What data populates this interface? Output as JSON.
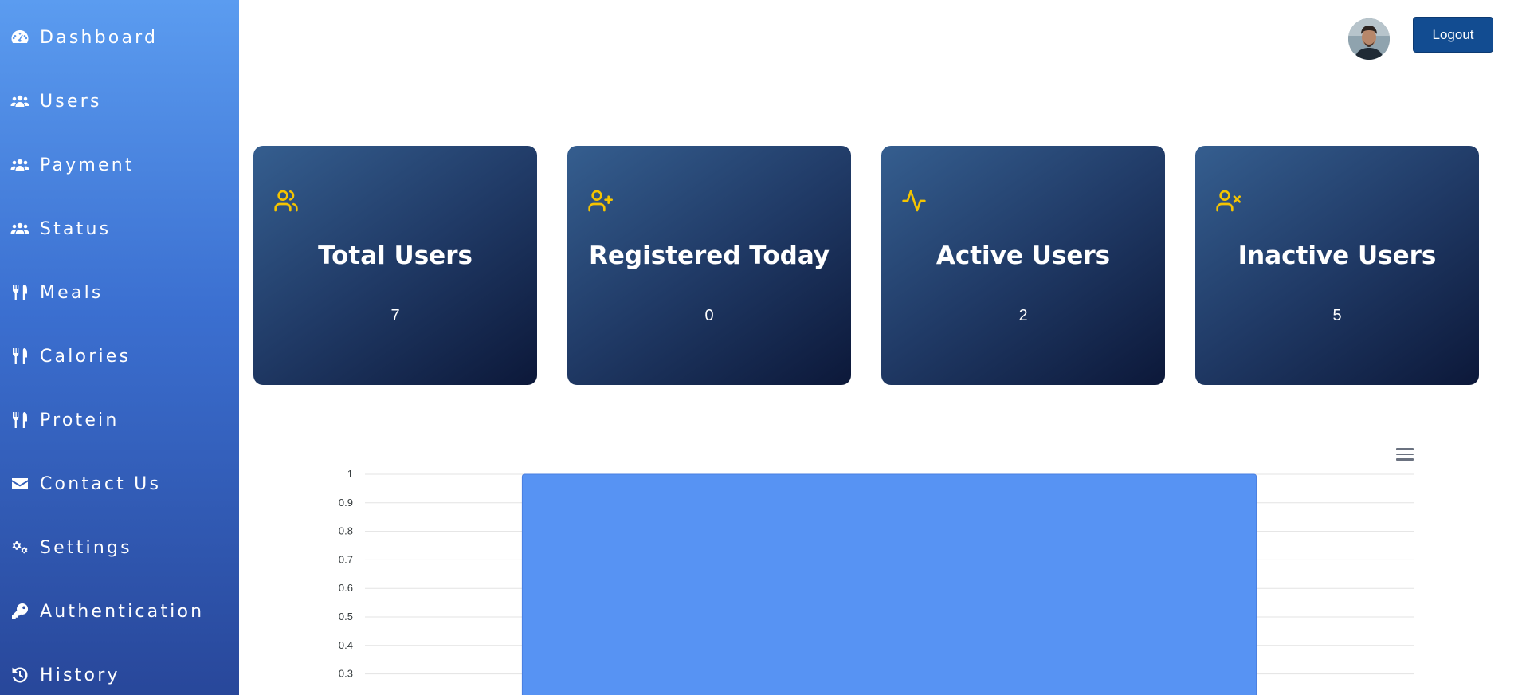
{
  "sidebar": {
    "items": [
      {
        "label": "Dashboard",
        "icon": "gauge-icon"
      },
      {
        "label": "Users",
        "icon": "users-icon"
      },
      {
        "label": "Payment",
        "icon": "users-icon"
      },
      {
        "label": "Status",
        "icon": "users-icon"
      },
      {
        "label": "Meals",
        "icon": "utensils-icon"
      },
      {
        "label": "Calories",
        "icon": "utensils-icon"
      },
      {
        "label": "Protein",
        "icon": "utensils-icon"
      },
      {
        "label": "Contact Us",
        "icon": "envelope-icon"
      },
      {
        "label": "Settings",
        "icon": "gears-icon"
      },
      {
        "label": "Authentication",
        "icon": "key-icon"
      },
      {
        "label": "History",
        "icon": "history-icon"
      }
    ]
  },
  "header": {
    "logout_label": "Logout",
    "avatar_icon": "avatar"
  },
  "cards": [
    {
      "title": "Total Users",
      "value": "7",
      "icon": "users-outline-icon"
    },
    {
      "title": "Registered Today",
      "value": "0",
      "icon": "user-plus-icon"
    },
    {
      "title": "Active Users",
      "value": "2",
      "icon": "activity-icon"
    },
    {
      "title": "Inactive Users",
      "value": "5",
      "icon": "user-x-icon"
    }
  ],
  "colors": {
    "accent_icon": "#f5c400",
    "bar": "#5793f3",
    "logout": "#124c91"
  },
  "chart_data": {
    "type": "bar",
    "categories": [
      ""
    ],
    "values": [
      1
    ],
    "ylim": [
      0.3,
      1
    ],
    "yticks": [
      "1",
      "0.9",
      "0.8",
      "0.7",
      "0.6",
      "0.5",
      "0.4",
      "0.3"
    ],
    "grid": true,
    "title": "",
    "xlabel": "",
    "ylabel": ""
  }
}
